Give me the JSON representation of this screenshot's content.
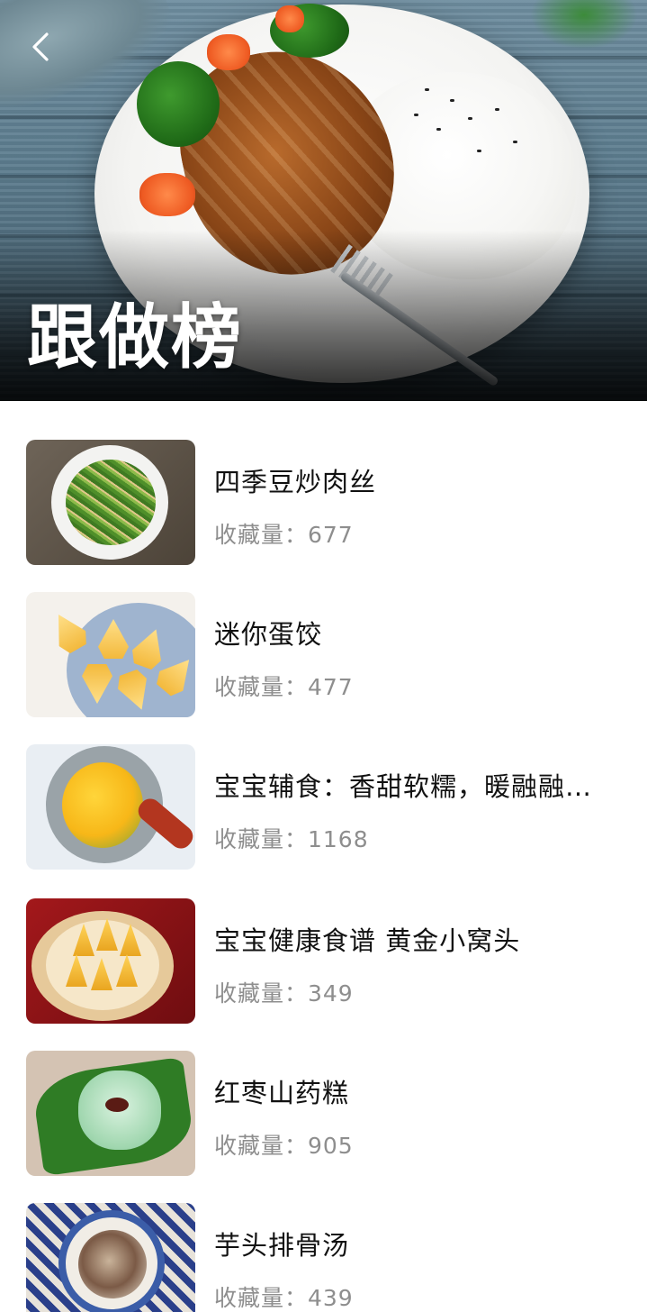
{
  "header": {
    "title": "跟做榜",
    "back_icon": "chevron-left-icon"
  },
  "colors": {
    "title_text": "#ffffff",
    "item_title": "#111111",
    "item_meta": "#8e8e8e",
    "background": "#ffffff"
  },
  "recipes": [
    {
      "title": "四季豆炒肉丝",
      "favorites": "收藏量：677"
    },
    {
      "title": "迷你蛋饺",
      "favorites": "收藏量：477"
    },
    {
      "title": "宝宝辅食：香甜软糯，暖融融的南瓜羹",
      "favorites": "收藏量：1168"
    },
    {
      "title": "宝宝健康食谱  黄金小窝头",
      "favorites": "收藏量：349"
    },
    {
      "title": "红枣山药糕",
      "favorites": "收藏量：905"
    },
    {
      "title": "芋头排骨汤",
      "favorites": "收藏量：439"
    }
  ]
}
